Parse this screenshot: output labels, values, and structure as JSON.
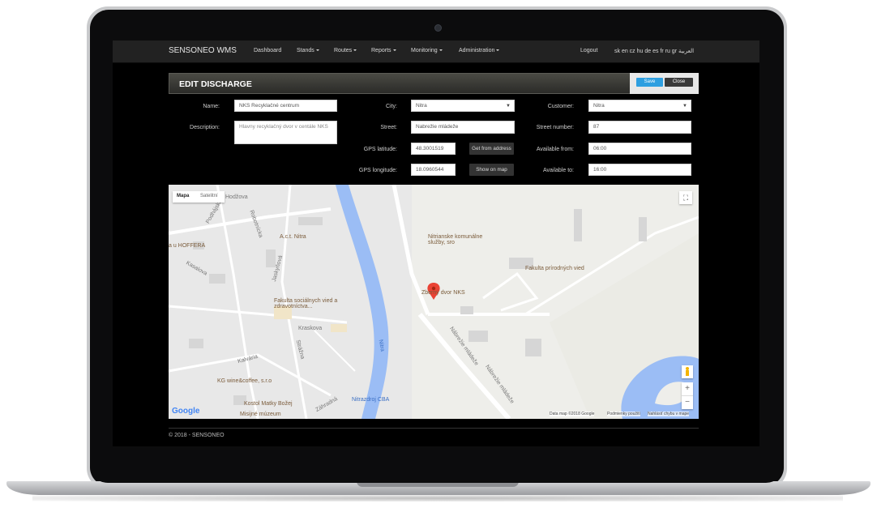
{
  "navbar": {
    "brand": "SENSONEO WMS",
    "items": [
      "Dashboard",
      "Stands",
      "Routes",
      "Reports",
      "Monitoring",
      "Administration"
    ],
    "logout": "Logout",
    "languages": "sk en cz hu de es fr ru gr العربية"
  },
  "panel": {
    "title": "EDIT DISCHARGE",
    "save": "Save",
    "close": "Close"
  },
  "form": {
    "name_label": "Name:",
    "name_value": "NKS Recyklačné centrum",
    "description_label": "Description:",
    "description_value": "Hlavny recyklačný dvor v centále NKS",
    "city_label": "City:",
    "city_value": "Nitra",
    "street_label": "Street:",
    "street_value": "Nabrežie mládeže",
    "gps_lat_label": "GPS latitude:",
    "gps_lat_value": "48.3001519",
    "gps_lon_label": "GPS longitude:",
    "gps_lon_value": "18.0960544",
    "get_from_address": "Get from address",
    "show_on_map": "Show on map",
    "customer_label": "Customer:",
    "customer_value": "Nitra",
    "street_number_label": "Street number:",
    "street_number_value": "87",
    "available_from_label": "Available from:",
    "available_from_value": "06:00",
    "available_to_label": "Available to:",
    "available_to_value": "16:00"
  },
  "map": {
    "tab_map": "Mapa",
    "tab_satellite": "Satelitní",
    "labels": {
      "act": "A.c.t. Nitra",
      "services": "Nitrianske komunálne služby, sro",
      "faculty_nat": "Fakulta prírodných vied",
      "dvor": "Zberný dvor NKS",
      "faculty_soc": "Fakulta sociálnych vied a zdravotníctva...",
      "kg": "KG wine&coffee, s.r.o",
      "kostol": "Kostol Matky Božej",
      "misijne": "Misijné múzeum",
      "cba": "Nitrazdroj CBA",
      "hoffera": "a u HOFFERA",
      "river": "Nitra",
      "street1": "Nábrežie mládeže",
      "street2": "Nábrežie mládeže",
      "kasalova": "Kasalova",
      "kraskova": "Kraskova",
      "strazna": "Strážna",
      "kalvaria": "Kalvária",
      "zahradna": "Záhradná",
      "hodzova": "Hodžova",
      "robotnicka": "Robotnícka",
      "jaskyniarska": "Jaskyňová",
      "pod_hojna": "Podhájska"
    },
    "google": "Google",
    "footer_data": "Data map ©2018 Google",
    "footer_terms": "Podmienky použití",
    "footer_report": "Nahlásiť chybu v mape",
    "fullscreen_icon": "fullscreen-icon"
  },
  "footer": "© 2018 - SENSONEO"
}
